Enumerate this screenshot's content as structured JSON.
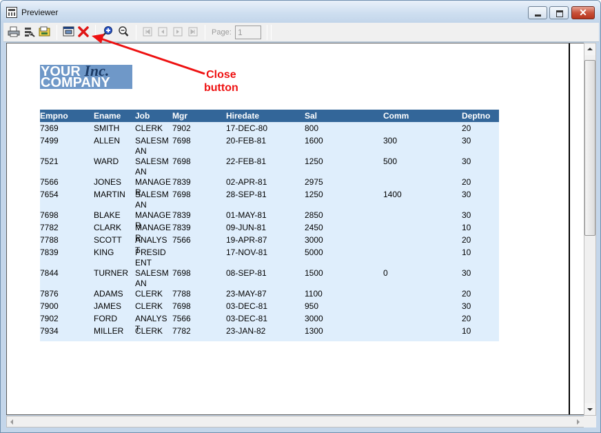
{
  "window": {
    "title": "Previewer",
    "close_glyph": "✕"
  },
  "toolbar": {
    "icons": [
      "print-icon",
      "print-setup-icon",
      "export-icon",
      "page-setup-icon",
      "close-report-icon",
      "zoom-in-icon",
      "zoom-out-icon",
      "first-page-icon",
      "previous-page-icon",
      "next-page-icon",
      "last-page-icon"
    ],
    "page_label": "Page:",
    "page_value": "1"
  },
  "report": {
    "logo_line1_a": "YOUR",
    "logo_line1_b": "Inc.",
    "logo_line2": "COMPANY",
    "columns": [
      "Empno",
      "Ename",
      "Job",
      "Mgr",
      "Hiredate",
      "Sal",
      "Comm",
      "Deptno"
    ],
    "rows": [
      [
        "7369",
        "SMITH",
        "CLERK",
        "7902",
        "17-DEC-80",
        "800",
        "",
        "20"
      ],
      [
        "7499",
        "ALLEN",
        "SALESMAN",
        "7698",
        "20-FEB-81",
        "1600",
        "300",
        "30"
      ],
      [
        "7521",
        "WARD",
        "SALESMAN",
        "7698",
        "22-FEB-81",
        "1250",
        "500",
        "30"
      ],
      [
        "7566",
        "JONES",
        "MANAGER",
        "7839",
        "02-APR-81",
        "2975",
        "",
        "20"
      ],
      [
        "7654",
        "MARTIN",
        "SALESMAN",
        "7698",
        "28-SEP-81",
        "1250",
        "1400",
        "30"
      ],
      [
        "7698",
        "BLAKE",
        "MANAGER",
        "7839",
        "01-MAY-81",
        "2850",
        "",
        "30"
      ],
      [
        "7782",
        "CLARK",
        "MANAGER",
        "7839",
        "09-JUN-81",
        "2450",
        "",
        "10"
      ],
      [
        "7788",
        "SCOTT",
        "ANALYST",
        "7566",
        "19-APR-87",
        "3000",
        "",
        "20"
      ],
      [
        "7839",
        "KING",
        "PRESIDENT",
        "",
        "17-NOV-81",
        "5000",
        "",
        "10"
      ],
      [
        "7844",
        "TURNER",
        "SALESMAN",
        "7698",
        "08-SEP-81",
        "1500",
        "0",
        "30"
      ],
      [
        "7876",
        "ADAMS",
        "CLERK",
        "7788",
        "23-MAY-87",
        "1100",
        "",
        "20"
      ],
      [
        "7900",
        "JAMES",
        "CLERK",
        "7698",
        "03-DEC-81",
        "950",
        "",
        "30"
      ],
      [
        "7902",
        "FORD",
        "ANALYST",
        "7566",
        "03-DEC-81",
        "3000",
        "",
        "20"
      ],
      [
        "7934",
        "MILLER",
        "CLERK",
        "7782",
        "23-JAN-82",
        "1300",
        "",
        "10"
      ]
    ]
  },
  "annotation": {
    "line1": "Close",
    "line2": "button",
    "color": "#ee1111"
  },
  "colors": {
    "header_bg": "#336699",
    "row_bg": "#dfeefc",
    "logo_bg": "#6f98c8"
  }
}
